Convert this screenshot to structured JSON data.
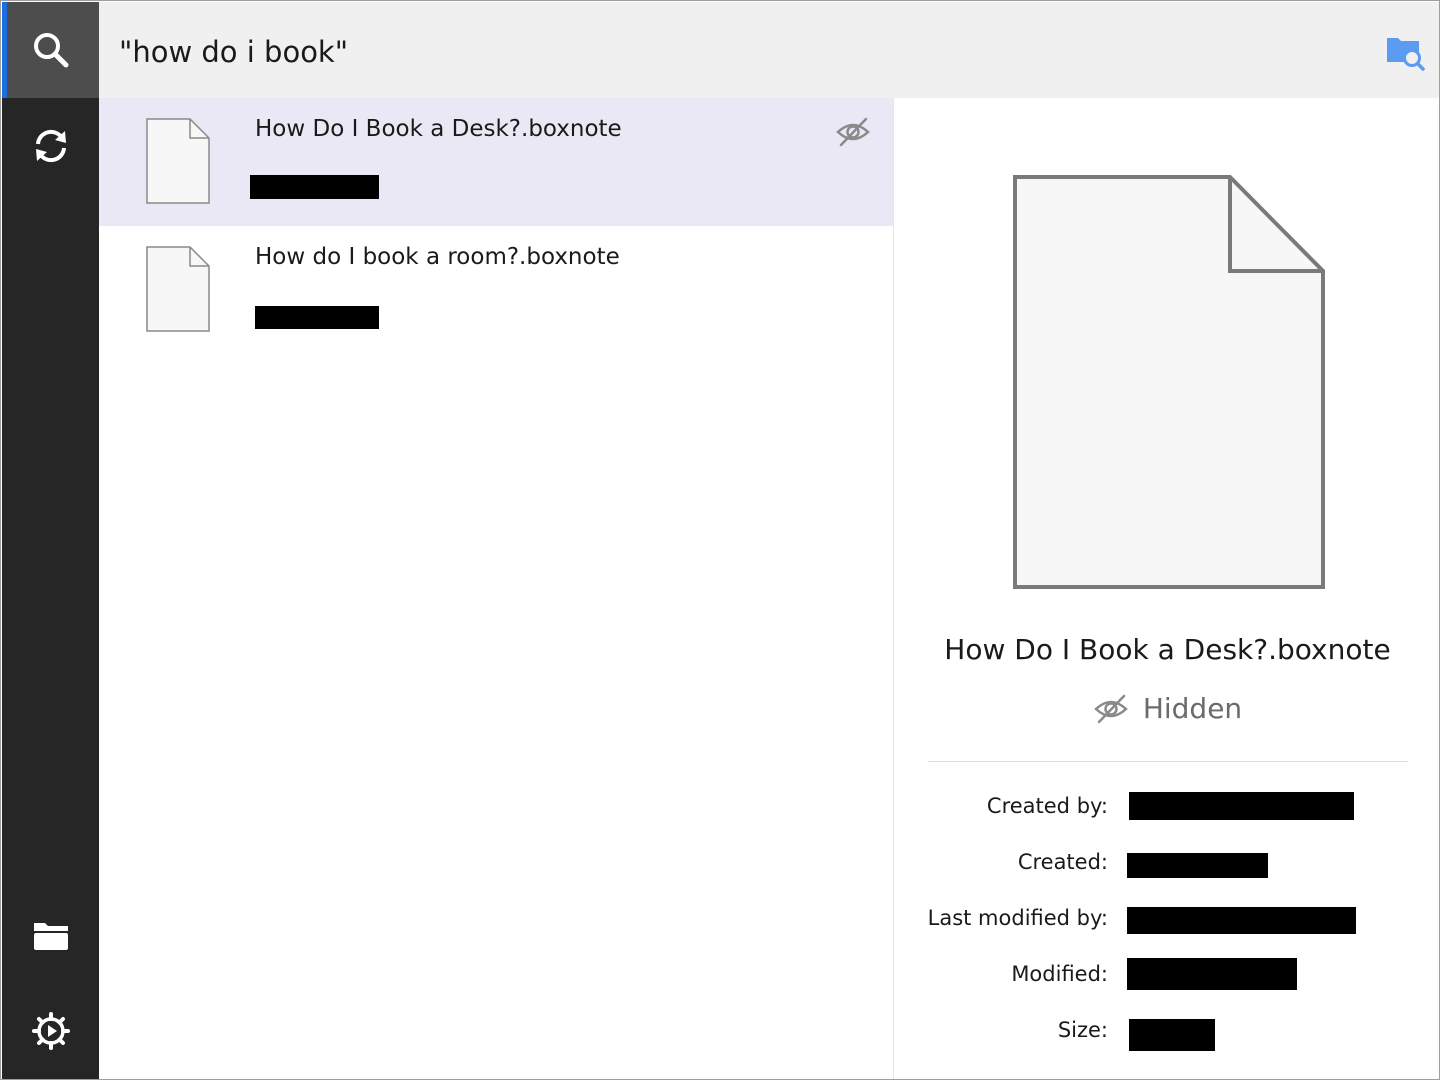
{
  "search": {
    "query": "\"how do i book\""
  },
  "sidebar": {
    "items": [
      {
        "name": "search",
        "icon": "search-icon",
        "active": true
      },
      {
        "name": "sync",
        "icon": "sync-icon",
        "active": false
      },
      {
        "name": "folder",
        "icon": "folder-icon",
        "active": false
      },
      {
        "name": "settings",
        "icon": "settings-gear-icon",
        "active": false
      }
    ]
  },
  "results": [
    {
      "title": "How Do I Book a Desk?.boxnote",
      "selected": true,
      "hidden": true
    },
    {
      "title": "How do I book a room?.boxnote",
      "selected": false,
      "hidden": false
    }
  ],
  "details": {
    "title": "How Do I Book a Desk?.boxnote",
    "status": "Hidden",
    "labels": {
      "created_by": "Created by:",
      "created": "Created:",
      "last_modified_by": "Last modified by:",
      "modified": "Modified:",
      "size": "Size:"
    }
  },
  "colors": {
    "accent": "#1a6fe0",
    "rail": "#262626",
    "rail_active": "#4d4d4d",
    "selected_row": "#ebe8f5",
    "search_bg": "#f0f0f0",
    "folder_search_icon": "#5b9bf0"
  }
}
